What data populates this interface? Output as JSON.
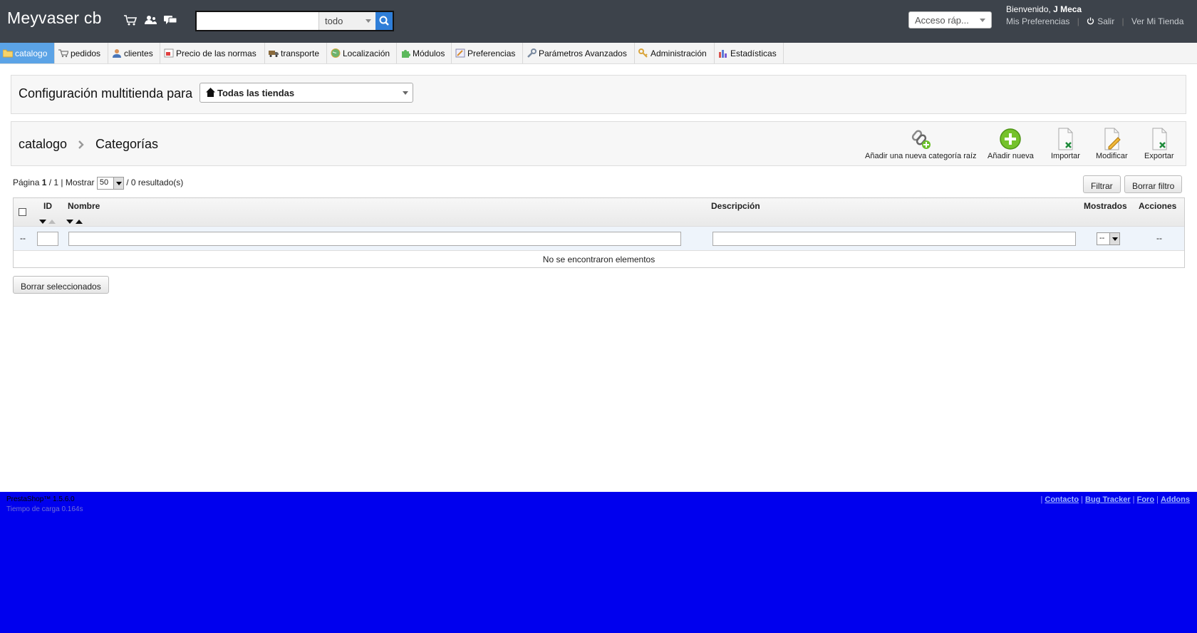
{
  "header": {
    "shop_name": "Meyvaser cb",
    "icons": [
      "cart-icon",
      "users-icon",
      "messages-icon"
    ],
    "search": {
      "value": "",
      "placeholder": "",
      "type_selected": "todo"
    },
    "quick_access_label": "Acceso ráp...",
    "welcome_prefix": "Bienvenido,",
    "user_name": "J Meca",
    "links": {
      "preferences": "Mis Preferencias",
      "logout": "Salir",
      "view_shop": "Ver Mi Tienda"
    }
  },
  "menu": {
    "tabs": [
      {
        "label": "catalogo",
        "icon": "folder-icon",
        "active": true
      },
      {
        "label": "pedidos",
        "icon": "cart-icon"
      },
      {
        "label": "clientes",
        "icon": "user-icon"
      },
      {
        "label": "Precio de las normas",
        "icon": "price-rules-icon"
      },
      {
        "label": "transporte",
        "icon": "truck-icon"
      },
      {
        "label": "Localización",
        "icon": "globe-icon"
      },
      {
        "label": "Módulos",
        "icon": "puzzle-icon"
      },
      {
        "label": "Preferencias",
        "icon": "preferences-icon"
      },
      {
        "label": "Parámetros Avanzados",
        "icon": "wrench-icon"
      },
      {
        "label": "Administración",
        "icon": "key-icon"
      },
      {
        "label": "Estadísticas",
        "icon": "stats-icon"
      }
    ]
  },
  "multishop": {
    "label": "Configuración multitienda para",
    "selected": "Todas las tiendas"
  },
  "toolbar": {
    "breadcrumb": {
      "root": "catalogo",
      "current": "Categorías"
    },
    "buttons": {
      "add_root": "Añadir una nueva categoría raíz",
      "add_new": "Añadir nueva",
      "import": "Importar",
      "modify": "Modificar",
      "export": "Exportar"
    }
  },
  "list": {
    "pager": {
      "page_label": "Página",
      "page": "1",
      "of": "/ 1 | Mostrar",
      "per_page": "50",
      "results": "/ 0 resultado(s)"
    },
    "filter_button": "Filtrar",
    "reset_filter_button": "Borrar filtro",
    "columns": {
      "id": "ID",
      "name": "Nombre",
      "description": "Descripción",
      "shown": "Mostrados",
      "actions": "Acciones"
    },
    "filter_row": {
      "left_placeholder": "--",
      "shown_value": "--",
      "actions_value": "--"
    },
    "empty_message": "No se encontraron elementos",
    "bulk_delete_button": "Borrar seleccionados"
  },
  "footer": {
    "version": "PrestaShop™ 1.5.6.0",
    "load_time": "Tiempo de carga 0.164s",
    "links": [
      "Contacto",
      "Bug Tracker",
      "Foro",
      "Addons"
    ]
  }
}
